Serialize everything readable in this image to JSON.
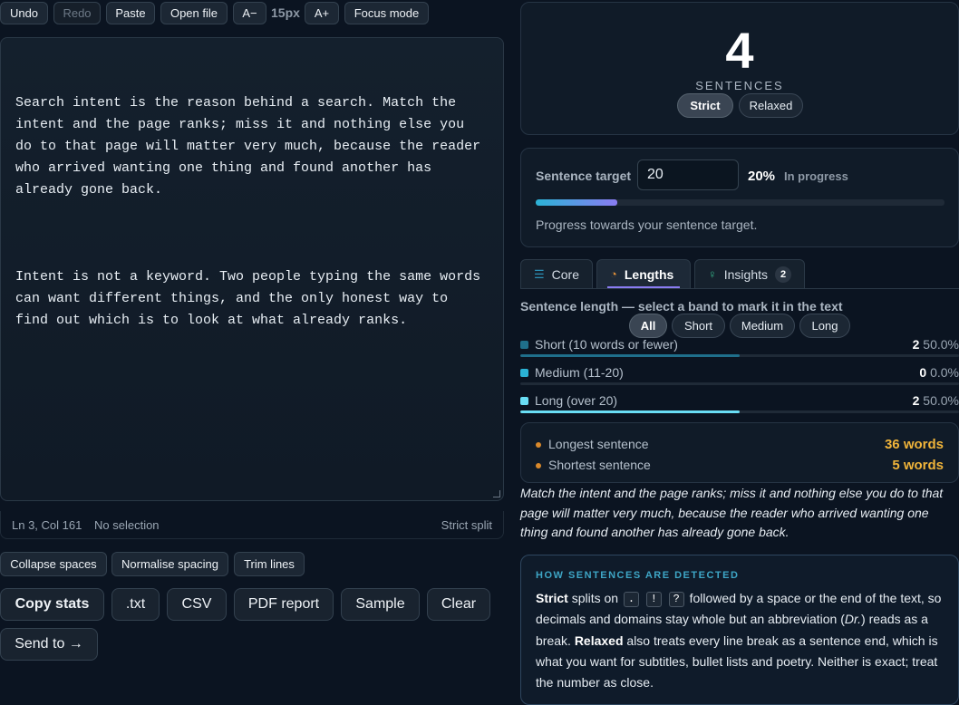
{
  "toolbar": {
    "undo": "Undo",
    "redo": "Redo",
    "paste": "Paste",
    "open_file": "Open file",
    "font_decrease": "A−",
    "font_size": "15px",
    "font_increase": "A+",
    "focus_mode": "Focus mode"
  },
  "editor": {
    "paragraphs": [
      "Search intent is the reason behind a search. Match the intent and the page ranks; miss it and nothing else you do to that page will matter very much, because the reader who arrived wanting one thing and found another has already gone back.",
      "Intent is not a keyword. Two people typing the same words can want different things, and the only honest way to find out which is to look at what already ranks."
    ]
  },
  "status": {
    "cursor": "Ln 3, Col 161",
    "selection": "No selection",
    "mode": "Strict split"
  },
  "text_tools": {
    "collapse_spaces": "Collapse spaces",
    "normalise_spacing": "Normalise spacing",
    "trim_lines": "Trim lines"
  },
  "actions": {
    "copy_stats": "Copy stats",
    "txt": ".txt",
    "csv": "CSV",
    "pdf_report": "PDF report",
    "sample": "Sample",
    "clear": "Clear",
    "send_to": "Send to →"
  },
  "count": {
    "value": "4",
    "label": "SENTENCES",
    "modes": [
      "Strict",
      "Relaxed"
    ],
    "active_mode": "Strict"
  },
  "target": {
    "label": "Sentence target",
    "value": "20",
    "percent_text": "20%",
    "progress": 0.2,
    "state": "In progress",
    "help": "Progress towards your sentence target."
  },
  "tabs": {
    "core": "Core",
    "lengths": "Lengths",
    "insights": "Insights",
    "insights_badge": "2",
    "active": "Lengths"
  },
  "lengths": {
    "title": "Sentence length — select a band to mark it in the text",
    "filters": [
      "All",
      "Short",
      "Medium",
      "Long"
    ],
    "active_filter": "All",
    "bands": [
      {
        "label": "Short (10 words or fewer)",
        "count": "2",
        "percent": "50.0%",
        "fraction": 0.5,
        "color": "#1f6f8b"
      },
      {
        "label": "Medium (11-20)",
        "count": "0",
        "percent": "0.0%",
        "fraction": 0.0,
        "color": "#2bb3d6"
      },
      {
        "label": "Long (over 20)",
        "count": "2",
        "percent": "50.0%",
        "fraction": 0.5,
        "color": "#69def5"
      }
    ]
  },
  "extremes": {
    "longest_label": "Longest sentence",
    "longest_value": "36 words",
    "shortest_label": "Shortest sentence",
    "shortest_value": "5 words"
  },
  "preview": {
    "text": "Match the intent and the page ranks; miss it and nothing else you do to that page will matter very much, because the reader who arrived wanting one thing and found another has already gone back."
  },
  "detection": {
    "title": "HOW SENTENCES ARE DETECTED",
    "strict_word": "Strict",
    "splits_on": "splits on",
    "keys": [
      ".",
      "!",
      "?"
    ],
    "part1": "followed by a space or the end of the text, so decimals and domains stay whole but an abbreviation (",
    "abbr": "Dr.",
    "part2": ") reads as a break.",
    "relaxed_word": "Relaxed",
    "part3": "also treats every line break as a sentence end, which is what you want for subtitles, bullet lists and poetry. Neither is exact; treat the number as close."
  },
  "colors": {
    "accent": "#8a7cf2",
    "progress_start": "#2bb3d6",
    "progress_end": "#8a7cf2",
    "highlight": "#f0b43a"
  }
}
